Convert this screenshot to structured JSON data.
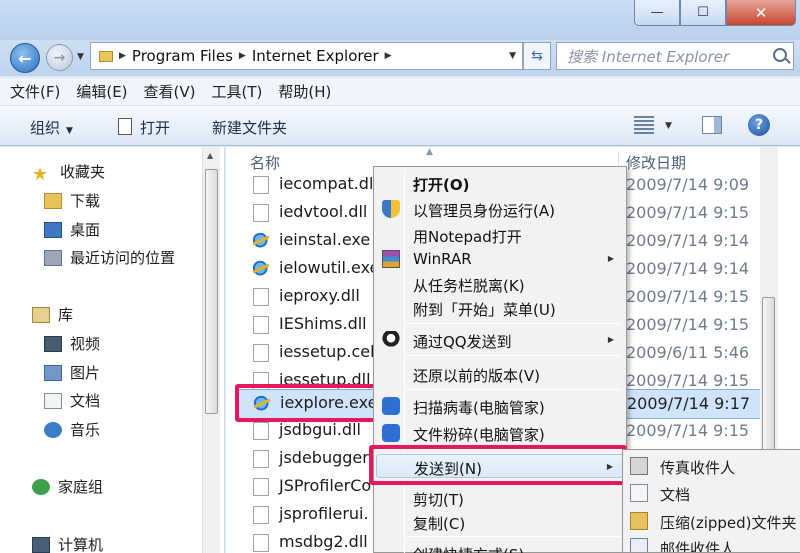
{
  "window": {
    "buttons": {
      "minimize": "—",
      "maximize": "☐",
      "close": "✕"
    }
  },
  "nav": {
    "back": "←",
    "forward": "→",
    "breadcrumb": [
      "Program Files",
      "Internet Explorer"
    ],
    "search_placeholder": "搜索 Internet Explorer"
  },
  "menubar": [
    "文件(F)",
    "编辑(E)",
    "查看(V)",
    "工具(T)",
    "帮助(H)"
  ],
  "toolbar": {
    "organize": "组织",
    "open": "打开",
    "new_folder": "新建文件夹",
    "help": "?"
  },
  "sidebar": {
    "favorites": "收藏夹",
    "favorites_items": [
      "下载",
      "桌面",
      "最近访问的位置"
    ],
    "libraries": "库",
    "library_items": [
      "视频",
      "图片",
      "文档",
      "音乐"
    ],
    "homegroup": "家庭组",
    "computer": "计算机"
  },
  "filelist": {
    "col_name": "名称",
    "col_date": "修改日期",
    "files": [
      {
        "name": "iecompat.dll",
        "date": "2009/7/14 9:09",
        "type": "dll"
      },
      {
        "name": "iedvtool.dll",
        "date": "2009/7/14 9:15",
        "type": "dll"
      },
      {
        "name": "ieinstal.exe",
        "date": "2009/7/14 9:14",
        "type": "exe"
      },
      {
        "name": "ielowutil.exe",
        "date": "2009/7/14 9:14",
        "type": "exe"
      },
      {
        "name": "ieproxy.dll",
        "date": "2009/7/14 9:15",
        "type": "dll"
      },
      {
        "name": "IEShims.dll",
        "date": "2009/7/14 9:15",
        "type": "dll"
      },
      {
        "name": "iessetup.ceb",
        "date": "2009/6/11 5:46",
        "type": "file"
      },
      {
        "name": "iessetup.dll",
        "date": "2009/7/14 9:15",
        "type": "dll"
      },
      {
        "name": "iexplore.exe",
        "date": "2009/7/14 9:17",
        "type": "exe"
      },
      {
        "name": "jsdbgui.dll",
        "date": "2009/7/14 9:15",
        "type": "dll"
      },
      {
        "name": "jsdebugger",
        "date": "",
        "type": "dll"
      },
      {
        "name": "JSProfilerCo",
        "date": "",
        "type": "dll"
      },
      {
        "name": "jsprofilerui.",
        "date": "",
        "type": "dll"
      },
      {
        "name": "msdbg2.dll",
        "date": "",
        "type": "dll"
      }
    ]
  },
  "context_menu": {
    "items": [
      "打开(O)",
      "以管理员身份运行(A)",
      "用Notepad打开",
      "WinRAR",
      "从任务栏脱离(K)",
      "附到「开始」菜单(U)",
      "通过QQ发送到",
      "还原以前的版本(V)",
      "扫描病毒(电脑管家)",
      "文件粉碎(电脑管家)",
      "发送到(N)",
      "剪切(T)",
      "复制(C)",
      "创建快捷方式(S)"
    ]
  },
  "send_to_menu": {
    "items": [
      "传真收件人",
      "文档",
      "压缩(zipped)文件夹",
      "邮件收件人"
    ]
  },
  "colors": {
    "highlight": "#e8175d",
    "selection": "#cfe4fb"
  }
}
